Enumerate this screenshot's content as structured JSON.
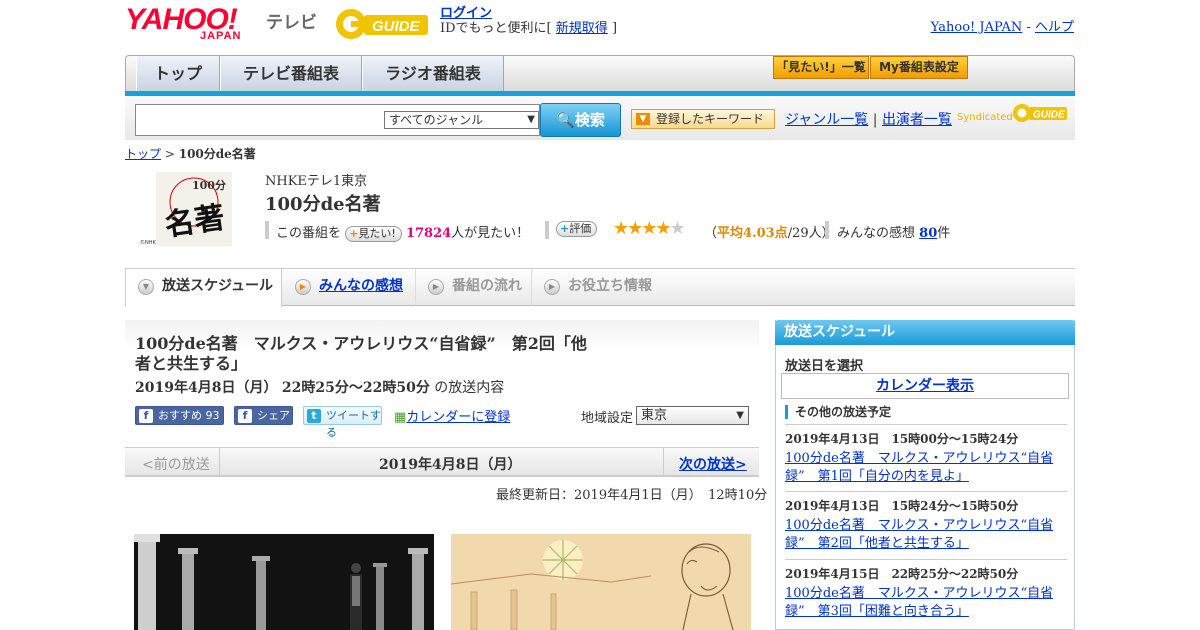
{
  "header": {
    "yahoo_logo": "YAHOO!",
    "yahoo_sub": "JAPAN",
    "tv_label": "テレビ",
    "gguide_logo": "G GUIDE",
    "login_label": "ログイン",
    "login_prompt": "IDでもっと便利に[",
    "signup_label": "新規取得",
    "login_close": "]",
    "yahoo_japan_link": "Yahoo! JAPAN",
    "link_separator": "-",
    "help_link": "ヘルプ"
  },
  "nav": {
    "tabs": [
      {
        "label": "トップ"
      },
      {
        "label": "テレビ番組表"
      },
      {
        "label": "ラジオ番組表"
      }
    ],
    "mitai_list": "「見たい!」一覧",
    "my_schedule": "My番組表設定"
  },
  "search": {
    "input_value": "",
    "genre_selected": "すべてのジャンル",
    "search_button": "検索",
    "keyword_button": "登録したキーワード",
    "genre_list_link": "ジャンル一覧",
    "separator": "|",
    "performer_list_link": "出演者一覧",
    "syndicated": "Syndicated"
  },
  "breadcrumb": {
    "top": "トップ",
    "sep": ">",
    "current": "100分de名著"
  },
  "program": {
    "logo_text": "名著",
    "logo_sub": "100分",
    "logo_credit": "©NHK",
    "channel": "NHKEテレ1東京",
    "title": "100分de名著",
    "mitai_prefix": "この番組を",
    "mitai_button": "見たい!",
    "mitai_count": "17824",
    "mitai_suffix": "人が見たい！",
    "rating_button": "評価",
    "stars_filled": "★★★★",
    "stars_empty": "★",
    "rating_open": "（",
    "rating_avg": "平均4.03点",
    "rating_count": "/29人）",
    "kanso_prefix": "みんなの感想",
    "kanso_count": "80",
    "kanso_suffix": "件"
  },
  "content_tabs": [
    {
      "label": "放送スケジュール",
      "icon": "chevron-down-icon"
    },
    {
      "label": "みんなの感想",
      "icon": "play-icon"
    },
    {
      "label": "番組の流れ",
      "icon": "play-icon"
    },
    {
      "label": "お役立ち情報",
      "icon": "play-icon"
    }
  ],
  "episode": {
    "title": "100分de名著　マルクス・アウレリウス“自省録”　第2回「他者と共生する」",
    "date": "2019年4月8日（月）",
    "time": "22時25分～22時50分",
    "date_suffix": "の放送内容",
    "fb_like": "おすすめ",
    "fb_like_count": "93",
    "fb_share": "シェア",
    "tweet": "ツイートする",
    "calendar_register": "カレンダーに登録",
    "region_label": "地域設定",
    "region_selected": "東京",
    "prev": "<前の放送",
    "current_date": "2019年4月8日（月）",
    "next": "次の放送>",
    "updated": "最終更新日：2019年4月1日（月）　12時10分"
  },
  "sidebar": {
    "title": "放送スケジュール",
    "select_label": "放送日を選択",
    "calendar_button": "カレンダー表示",
    "other_title": "その他の放送予定",
    "items": [
      {
        "date": "2019年4月13日　15時00分～15時24分",
        "title": "100分de名著　マルクス・アウレリウス“自省録”　第1回「自分の内を見よ」"
      },
      {
        "date": "2019年4月13日　15時24分～15時50分",
        "title": "100分de名著　マルクス・アウレリウス“自省録”　第2回「他者と共生する」"
      },
      {
        "date": "2019年4月15日　22時25分～22時50分",
        "title": "100分de名著　マルクス・アウレリウス“自省録”　第3回「困難と向き合う」"
      }
    ]
  },
  "colors": {
    "accent_blue": "#1a9ad8",
    "yahoo_red": "#ff0033",
    "link": "#0033cc",
    "mitai_pink": "#e4007f",
    "star": "#f3a100"
  }
}
